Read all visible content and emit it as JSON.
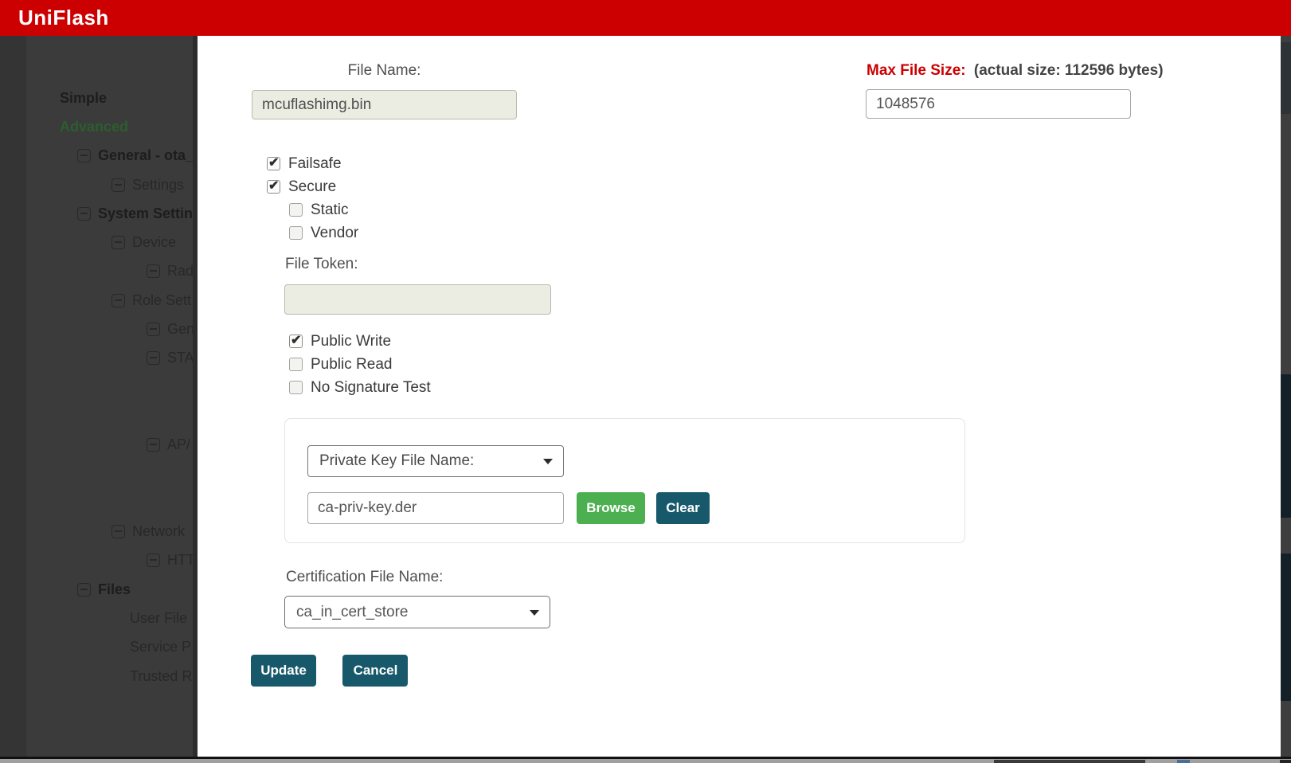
{
  "header": {
    "title": "UniFlash"
  },
  "colors": {
    "header_red": "#cc0000",
    "button_teal": "#17596b",
    "button_green": "#4caf50",
    "label_red": "#cc0000"
  },
  "sidebar": {
    "items": [
      {
        "label": "Simple",
        "depth": 0,
        "icon": false,
        "bold": true
      },
      {
        "label": "Advanced",
        "depth": 0,
        "icon": false,
        "bold": true,
        "green": true
      },
      {
        "label": "General - ota_",
        "depth": 1,
        "icon": true,
        "bold": true
      },
      {
        "label": "Settings",
        "depth": 2,
        "icon": true
      },
      {
        "label": "System Settin",
        "depth": 1,
        "icon": true,
        "bold": true
      },
      {
        "label": "Device",
        "depth": 2,
        "icon": true
      },
      {
        "label": "Rad",
        "depth": 3,
        "icon": true
      },
      {
        "label": "Role Sett",
        "depth": 2,
        "icon": true
      },
      {
        "label": "Gen",
        "depth": 3,
        "icon": true
      },
      {
        "label": "STA",
        "depth": 3,
        "icon": true
      },
      {
        "label": "",
        "spacer": true,
        "depth": 3,
        "icon": false
      },
      {
        "label": "",
        "spacer": true,
        "depth": 3,
        "icon": false
      },
      {
        "label": "AP/",
        "depth": 3,
        "icon": true
      },
      {
        "label": "",
        "spacer": true,
        "depth": 3,
        "icon": false
      },
      {
        "label": "",
        "spacer": true,
        "depth": 3,
        "icon": false
      },
      {
        "label": "Network",
        "depth": 2,
        "icon": true
      },
      {
        "label": "HTT",
        "depth": 3,
        "icon": true
      },
      {
        "label": "Files",
        "depth": 1,
        "icon": true,
        "bold": true
      },
      {
        "label": "User File",
        "depth": 2,
        "icon": false
      },
      {
        "label": "Service P",
        "depth": 2,
        "icon": false
      },
      {
        "label": "Trusted R",
        "depth": 2,
        "icon": false
      }
    ]
  },
  "form": {
    "file_name": {
      "label": "File Name:",
      "value": "mcuflashimg.bin"
    },
    "max_file_size": {
      "label": "Max File Size:",
      "note": "(actual size: 112596 bytes)",
      "value": "1048576"
    },
    "checks_top": [
      {
        "label": "Failsafe",
        "checked": true,
        "indent": 0
      },
      {
        "label": "Secure",
        "checked": true,
        "indent": 0
      },
      {
        "label": "Static",
        "checked": false,
        "indent": 1
      },
      {
        "label": "Vendor",
        "checked": false,
        "indent": 1
      }
    ],
    "file_token": {
      "label": "File Token:",
      "value": ""
    },
    "checks_access": [
      {
        "label": "Public Write",
        "checked": true
      },
      {
        "label": "Public Read",
        "checked": false
      },
      {
        "label": "No Signature Test",
        "checked": false
      }
    ],
    "key_section": {
      "select_value": "Private Key File Name:",
      "file_value": "ca-priv-key.der",
      "browse_label": "Browse",
      "clear_label": "Clear"
    },
    "cert": {
      "label": "Certification File Name:",
      "value": "ca_in_cert_store"
    },
    "actions": {
      "update_label": "Update",
      "cancel_label": "Cancel"
    }
  }
}
